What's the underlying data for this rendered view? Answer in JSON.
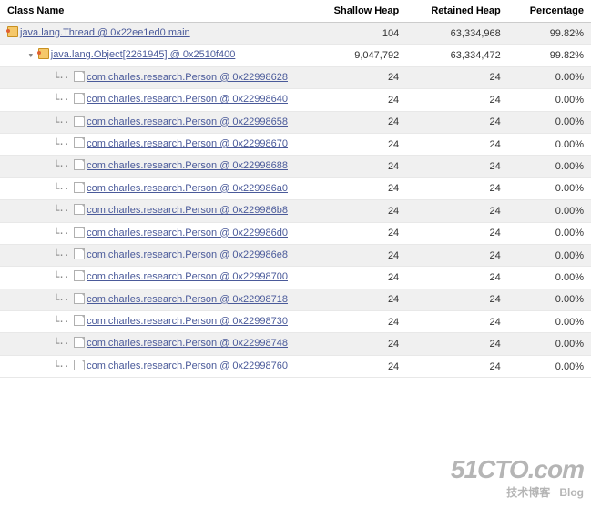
{
  "columns": {
    "name": "Class Name",
    "shallow": "Shallow Heap",
    "retained": "Retained Heap",
    "pct": "Percentage"
  },
  "rows": [
    {
      "indent": 0,
      "alt": true,
      "icon": "obj",
      "label": "java.lang.Thread @ 0x22ee1ed0 main",
      "shallow": "104",
      "retained": "63,334,968",
      "pct": "99.82%"
    },
    {
      "indent": 1,
      "alt": false,
      "icon": "obj",
      "label": "java.lang.Object[2261945] @ 0x2510f400",
      "shallow": "9,047,792",
      "retained": "63,334,472",
      "pct": "99.82%"
    },
    {
      "indent": 2,
      "alt": true,
      "icon": "class",
      "label": "com.charles.research.Person @ 0x22998628",
      "shallow": "24",
      "retained": "24",
      "pct": "0.00%"
    },
    {
      "indent": 2,
      "alt": false,
      "icon": "class",
      "label": "com.charles.research.Person @ 0x22998640",
      "shallow": "24",
      "retained": "24",
      "pct": "0.00%"
    },
    {
      "indent": 2,
      "alt": true,
      "icon": "class",
      "label": "com.charles.research.Person @ 0x22998658",
      "shallow": "24",
      "retained": "24",
      "pct": "0.00%"
    },
    {
      "indent": 2,
      "alt": false,
      "icon": "class",
      "label": "com.charles.research.Person @ 0x22998670",
      "shallow": "24",
      "retained": "24",
      "pct": "0.00%"
    },
    {
      "indent": 2,
      "alt": true,
      "icon": "class",
      "label": "com.charles.research.Person @ 0x22998688",
      "shallow": "24",
      "retained": "24",
      "pct": "0.00%"
    },
    {
      "indent": 2,
      "alt": false,
      "icon": "class",
      "label": "com.charles.research.Person @ 0x229986a0",
      "shallow": "24",
      "retained": "24",
      "pct": "0.00%"
    },
    {
      "indent": 2,
      "alt": true,
      "icon": "class",
      "label": "com.charles.research.Person @ 0x229986b8",
      "shallow": "24",
      "retained": "24",
      "pct": "0.00%"
    },
    {
      "indent": 2,
      "alt": false,
      "icon": "class",
      "label": "com.charles.research.Person @ 0x229986d0",
      "shallow": "24",
      "retained": "24",
      "pct": "0.00%"
    },
    {
      "indent": 2,
      "alt": true,
      "icon": "class",
      "label": "com.charles.research.Person @ 0x229986e8",
      "shallow": "24",
      "retained": "24",
      "pct": "0.00%"
    },
    {
      "indent": 2,
      "alt": false,
      "icon": "class",
      "label": "com.charles.research.Person @ 0x22998700",
      "shallow": "24",
      "retained": "24",
      "pct": "0.00%"
    },
    {
      "indent": 2,
      "alt": true,
      "icon": "class",
      "label": "com.charles.research.Person @ 0x22998718",
      "shallow": "24",
      "retained": "24",
      "pct": "0.00%"
    },
    {
      "indent": 2,
      "alt": false,
      "icon": "class",
      "label": "com.charles.research.Person @ 0x22998730",
      "shallow": "24",
      "retained": "24",
      "pct": "0.00%"
    },
    {
      "indent": 2,
      "alt": true,
      "icon": "class",
      "label": "com.charles.research.Person @ 0x22998748",
      "shallow": "24",
      "retained": "24",
      "pct": "0.00%"
    },
    {
      "indent": 2,
      "alt": false,
      "icon": "class",
      "label": "com.charles.research.Person @ 0x22998760",
      "shallow": "24",
      "retained": "24",
      "pct": "0.00%"
    }
  ],
  "watermark": {
    "main": "51CTO.com",
    "sub": "技术博客",
    "tag": "Blog"
  }
}
